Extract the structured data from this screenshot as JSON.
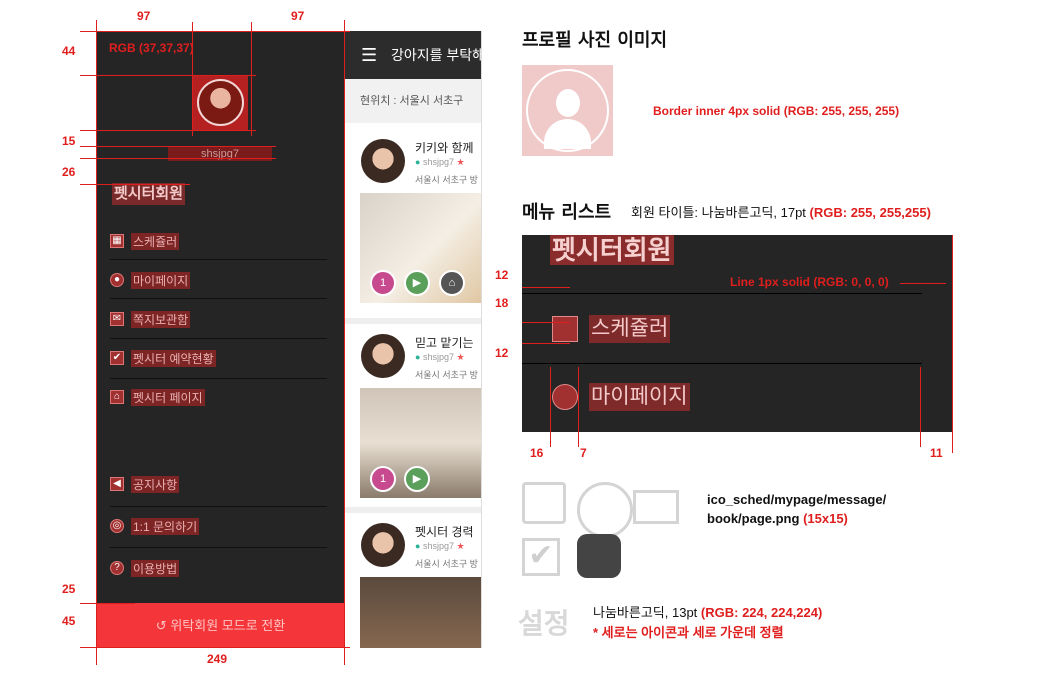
{
  "drawer": {
    "bg_color_label": "RGB (37,37,37)",
    "user_id": "shsjpg7",
    "member_title": "펫시터회원",
    "menu_top": [
      {
        "icon": "calendar-icon",
        "glyph": "▦",
        "label": "스케쥴러"
      },
      {
        "icon": "person-icon",
        "glyph": "●",
        "label": "마이페이지"
      },
      {
        "icon": "envelope-icon",
        "glyph": "✉",
        "label": "쪽지보관함"
      },
      {
        "icon": "checkbox-icon",
        "glyph": "✔",
        "label": "펫시터 예약현황"
      },
      {
        "icon": "dog-house-icon",
        "glyph": "⌂",
        "label": "펫시터 페이지"
      }
    ],
    "menu_bottom": [
      {
        "icon": "megaphone-icon",
        "glyph": "◀",
        "label": "공지사항"
      },
      {
        "icon": "headset-icon",
        "glyph": "◎",
        "label": "1:1 문의하기"
      },
      {
        "icon": "question-icon",
        "glyph": "?",
        "label": "이용방법"
      }
    ],
    "bottom_button": "위탁회원 모드로 전환",
    "bottom_icon": "↺"
  },
  "screen": {
    "menu_icon": "☰",
    "title": "강아지를 부탁해",
    "location": "현위치 : 서울시 서초구",
    "cards": [
      {
        "title": "키키와 함께",
        "user": "shsjpg7",
        "addr": "서울시 서초구 방"
      },
      {
        "title": "믿고 맡기는",
        "user": "shsjpg7",
        "addr": "서울시 서초구 방"
      },
      {
        "title": "펫시터 경력",
        "user": "shsjpg7",
        "addr": "서울시 서초구 방"
      }
    ]
  },
  "annotations": {
    "top_left": "97",
    "top_right": "97",
    "left_44": "44",
    "left_15": "15",
    "left_26": "26",
    "left_25": "25",
    "left_45": "45",
    "bottom_249": "249",
    "m12a": "12",
    "m18": "18",
    "m12b": "12",
    "m16": "16",
    "m7": "7",
    "m11": "11"
  },
  "right": {
    "profile_heading": "프로필 사진 이미지",
    "border_note": "Border inner 4px solid (RGB: 255, 255, 255)",
    "menu_heading": "메뉴 리스트",
    "menu_note_black": "회원 타이틀: 나눔바른고딕, 17pt",
    "menu_note_red": "(RGB: 255, 255,255)",
    "demo_title": "펫시터회원",
    "demo_items": [
      "스케쥴러",
      "마이페이지"
    ],
    "line_note": "Line 1px solid (RGB: 0, 0, 0)",
    "icon_note_line1": "ico_sched/mypage/message/",
    "icon_note_line2": "book/page.png",
    "icon_note_size": "(15x15)",
    "settings_text": "설정",
    "font_note_black": "나눔바른고딕, 13pt",
    "font_note_red": "(RGB: 224, 224,224)",
    "align_note": "* 세로는 아이콘과 세로 가운데 정렬"
  }
}
